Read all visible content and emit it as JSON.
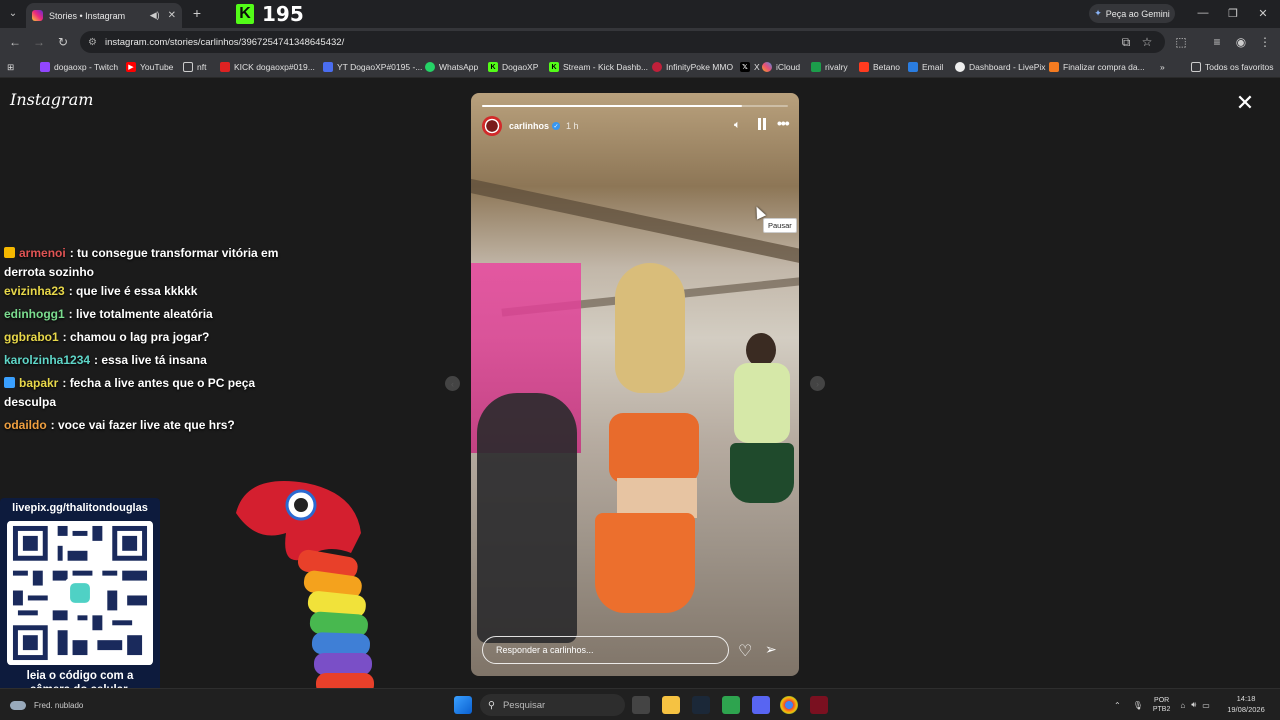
{
  "browser": {
    "tab_title": "Stories • Instagram",
    "new_tab_label": "+",
    "gemini_label": "Peça ao Gemini",
    "url": "instagram.com/stories/carlinhos/3967254741348645432/",
    "bookmarks": [
      "dogaoxp - Twitch",
      "YouTube",
      "nft",
      "KICK dogaoxp#019...",
      "YT DogaoXP#0195 -...",
      "WhatsApp",
      "DogaoXP",
      "Stream - Kick Dashb...",
      "InfinityPoke MMO",
      "X",
      "iCloud",
      "rivalry",
      "Betano",
      "Email",
      "Dashboard - LivePix",
      "Finalizar compra da..."
    ],
    "all_bookmarks_label": "Todos os favoritos"
  },
  "overlay": {
    "kick_count": "195",
    "kick_logo": "K"
  },
  "instagram": {
    "logo": "Instagram",
    "story_user": "carlinhos",
    "story_time": "1 h",
    "pause_tooltip": "Pausar",
    "reply_placeholder": "Responder a carlinhos...",
    "progress": 0.85
  },
  "chat": [
    {
      "user": "armenoi",
      "message": ": tu consegue transformar vitória em derrota sozinho",
      "color": "#e05454",
      "badge": "#f5b800"
    },
    {
      "user": "evizinha23",
      "message": ": que live é essa kkkkk",
      "color": "#e8d84a",
      "badge": ""
    },
    {
      "user": "edinhogg1",
      "message": ": live totalmente aleatória",
      "color": "#7bdc8f",
      "badge": ""
    },
    {
      "user": "ggbrabo1",
      "message": ": chamou o lag pra jogar?",
      "color": "#e8d84a",
      "badge": ""
    },
    {
      "user": "karolzinha1234",
      "message": ": essa live tá insana",
      "color": "#5fd6c8",
      "badge": ""
    },
    {
      "user": "bapakr",
      "message": ": fecha a live antes que o PC peça desculpa",
      "color": "#e8d84a",
      "badge": "#3aa0ff"
    },
    {
      "user": "odaildo",
      "message": ": voce vai fazer live ate que hrs?",
      "color": "#f0a040",
      "badge": ""
    }
  ],
  "qr_widget": {
    "url": "livepix.gg/thalitondouglas",
    "caption_line1": "leia o código com a",
    "caption_line2": "câmera do celular."
  },
  "taskbar": {
    "weather": "Fred. nublado",
    "search_placeholder": "Pesquisar",
    "lang_line1": "POR",
    "lang_line2": "PTB2",
    "time": "14:18",
    "date": "19/08/2026"
  },
  "colors": {
    "kick_green": "#53fc18",
    "instagram_gradient": "#ee2a7b",
    "verified_blue": "#3897f0"
  }
}
